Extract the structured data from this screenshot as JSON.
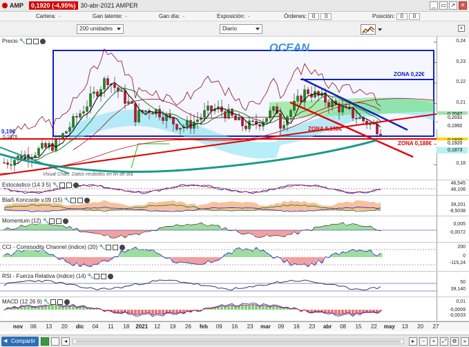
{
  "titlebar": {
    "symbol": "AMP",
    "price_change": "0,1920 (-4,95%)",
    "date_market": "30-abr-2021 AMPER",
    "win_buttons": [
      "_",
      "▭",
      "↗",
      "✕"
    ]
  },
  "info": {
    "cartera_label": "Cartera:",
    "cartera_val": "-",
    "gan_latente_label": "Gan latente:",
    "gan_latente_val": "-",
    "gan_dia_label": "Gan día:",
    "gan_dia_val": "-",
    "exposicion_label": "Exposición:",
    "exposicion_val": "-",
    "ordenes_label": "Órdenes:",
    "ordenes_a": "0",
    "ordenes_b": "0",
    "posicion_label": "Posición:",
    "posicion_a": "0",
    "posicion_b": "0"
  },
  "controls": {
    "units": "200 unidades",
    "period": "Diario",
    "expand": "+"
  },
  "price_panel": {
    "title": "Precio",
    "annotation_title": "OCEAN",
    "zona_022": "ZONA 0,22€",
    "zona_0198": "ZONA 0,198€",
    "zona_0188": "ZONA 0,188€",
    "left_price": "0,19€",
    "left_sub": "0,1876",
    "watermark": "Visual Chart. Datos recibidos en fin de día",
    "yticks": [
      {
        "label": "0,24",
        "v": 0.24
      },
      {
        "label": "0,23",
        "v": 0.23
      },
      {
        "label": "0,22",
        "v": 0.22
      },
      {
        "label": "0,21",
        "v": 0.21
      },
      {
        "label": "0,19",
        "v": 0.19
      },
      {
        "label": "0,18",
        "v": 0.18
      }
    ],
    "tags": [
      {
        "label": "0,2047",
        "color": "#9fe3a5",
        "v": 0.2047
      },
      {
        "label": "0,2031",
        "color": "#ffffff",
        "v": 0.2031
      },
      {
        "label": "0,1992",
        "color": "#ffffff",
        "v": 0.1992
      },
      {
        "label": "0,1920",
        "color": "#ffd400",
        "v": 0.192
      },
      {
        "label": "0,1920",
        "color": "#ffffff",
        "v": 0.1905
      },
      {
        "label": "0,1873",
        "color": "#b8f0f0",
        "v": 0.1873
      }
    ]
  },
  "indicators": [
    {
      "key": "stoch",
      "title": "Estocástico (14 3 5)",
      "tags": [
        "46,545",
        "46,106"
      ]
    },
    {
      "key": "blai",
      "title": "Blai5 Koncorde v.09 (15)",
      "tags": [
        "39,201",
        "-8,5038"
      ]
    },
    {
      "key": "mom",
      "title": "Momentum (12)",
      "tags": [
        "0,005",
        "-0,0072"
      ]
    },
    {
      "key": "cci",
      "title": "CCI - Commodity Channel (indice) (20)",
      "tags": [
        "200",
        "0",
        "-115,24"
      ]
    },
    {
      "key": "rsi",
      "title": "RSI - Fuerza Relativa (indice) (14)",
      "tags": [
        "50",
        "39,140"
      ]
    },
    {
      "key": "macd",
      "title": "MACD (12 26 9)",
      "tags": [
        "0,01",
        "-0,0009",
        "-0,0033"
      ]
    }
  ],
  "xaxis": [
    "nov",
    "06",
    "13",
    "20",
    "dic",
    "04",
    "11",
    "18",
    "2021",
    "12",
    "19",
    "26",
    "feb",
    "09",
    "16",
    "23",
    "mar",
    "09",
    "16",
    "23",
    "abr",
    "08",
    "15",
    "22",
    "may",
    "13",
    "20",
    "27"
  ],
  "bottombar": {
    "share": "Compartir"
  },
  "colors": {
    "accent": "#2a6fb5",
    "price_up": "#1a8c1a",
    "price_down": "#c8102e",
    "zone_blue": "#1020c0",
    "zone_red": "#e00000",
    "teal": "#1a9a8a"
  }
}
